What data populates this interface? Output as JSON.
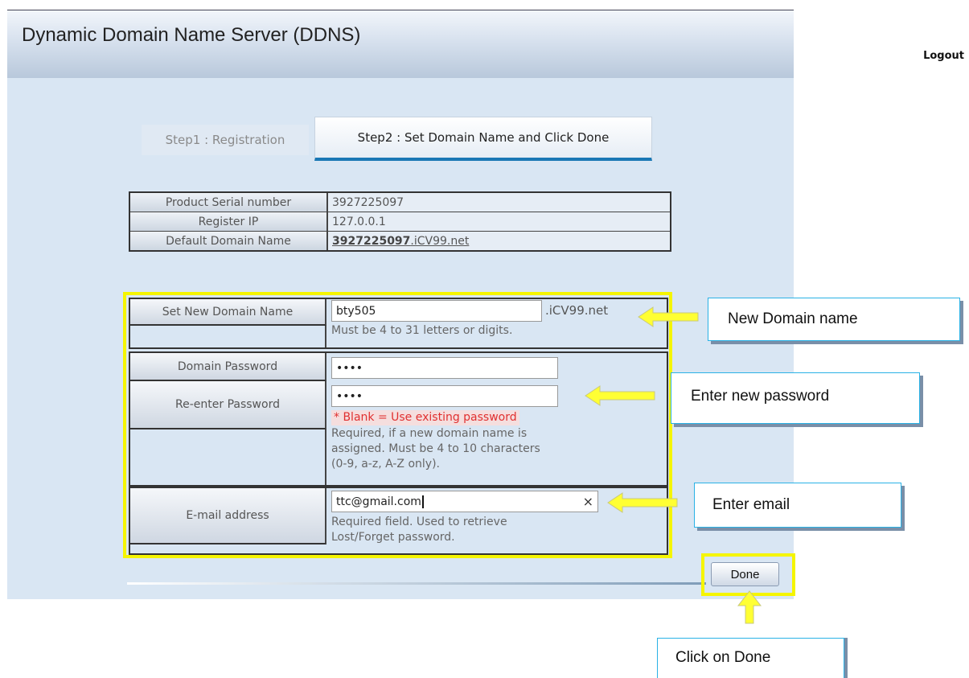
{
  "header": {
    "title": "Dynamic Domain Name Server (DDNS)",
    "logout": "Logout"
  },
  "tabs": [
    {
      "label": "Step1 : Registration",
      "active": false
    },
    {
      "label": "Step2 : Set Domain Name and Click Done",
      "active": true
    }
  ],
  "info": {
    "serial_label": "Product Serial number",
    "serial_value": "3927225097",
    "ip_label": "Register IP",
    "ip_value": "127.0.0.1",
    "domain_label": "Default Domain Name",
    "domain_bold": "3927225097",
    "domain_suffix": ".iCV99.net"
  },
  "form": {
    "new_domain_label": "Set New Domain Name",
    "new_domain_value": "bty505",
    "domain_suffix": ".iCV99.net",
    "new_domain_hint": "Must be 4 to 31 letters or digits.",
    "password_label": "Domain Password",
    "password_value": "••••",
    "reenter_label": "Re-enter Password",
    "reenter_value": "••••",
    "blank_note": "* Blank = Use existing password",
    "password_hint_1": "Required, if a new domain name is",
    "password_hint_2": "assigned. Must be 4 to 10 characters",
    "password_hint_3": "(0-9, a-z, A-Z only).",
    "email_label": "E-mail address",
    "email_value": "ttc@gmail.com",
    "email_clear": "×",
    "email_hint_1": "Required field. Used to retrieve",
    "email_hint_2": "Lost/Forget password."
  },
  "done_label": "Done",
  "callouts": {
    "domain": "New Domain name",
    "password": "Enter new password",
    "email": "Enter email",
    "done": "Click on Done"
  },
  "colors": {
    "highlight": "#f5f500",
    "arrow": "#ffff33",
    "tab_underline": "#1a78b5",
    "callout_border": "#2ab2e6"
  }
}
